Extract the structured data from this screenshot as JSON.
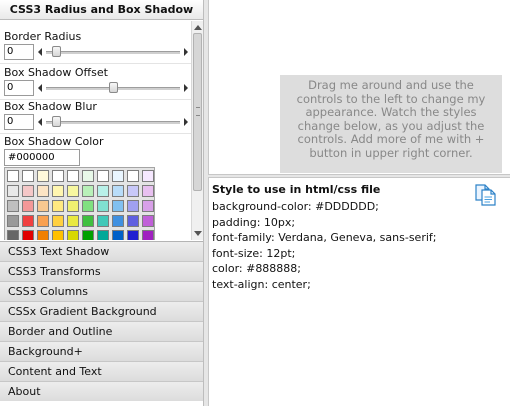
{
  "left_panel": {
    "header": "CSS3 Radius and Box Shadow",
    "controls": {
      "border_radius": {
        "label": "Border Radius",
        "value": "0",
        "slider_fraction": 0.05
      },
      "shadow_offset": {
        "label": "Box Shadow Offset",
        "value": "0",
        "slider_fraction": 0.5
      },
      "shadow_blur": {
        "label": "Box Shadow Blur",
        "value": "0",
        "slider_fraction": 0.05
      },
      "shadow_color": {
        "label": "Box Shadow Color",
        "value": "#000000"
      }
    },
    "palette_colors": [
      "#ffffff",
      "#ffffff",
      "#fff9db",
      "#ffffff",
      "#ffffff",
      "#e8f8e8",
      "#ffffff",
      "#eaf6ff",
      "#ffffff",
      "#f6e8ff",
      "#e8e8e8",
      "#f4c7c7",
      "#fce4c4",
      "#fff6b0",
      "#f7f7a0",
      "#b8f0b8",
      "#b8f0e8",
      "#b8dcf8",
      "#c8c8f8",
      "#e8c0f0",
      "#bfbfbf",
      "#f39898",
      "#f8c890",
      "#ffe880",
      "#f0f070",
      "#80e080",
      "#80e0d0",
      "#80c0f0",
      "#a0a0f0",
      "#d8a0e8",
      "#999999",
      "#f04040",
      "#f8a050",
      "#ffd040",
      "#e8e840",
      "#40c040",
      "#40c8b8",
      "#4090e0",
      "#6060e0",
      "#c060d8",
      "#666666",
      "#e00000",
      "#f08000",
      "#ffc000",
      "#d8d800",
      "#00a000",
      "#00a898",
      "#0060c8",
      "#2020d0",
      "#a020c0"
    ],
    "accordion_items": [
      "CSS3 Text Shadow",
      "CSS3 Transforms",
      "CSS3 Columns",
      "CSSx Gradient Background",
      "Border and Outline",
      "Background+",
      "Content and Text",
      "About"
    ]
  },
  "preview": {
    "text": "Drag me around and use the controls to the left to change my appearance. Watch the styles change below, as you adjust the controls. Add more of me with + button in upper right corner."
  },
  "css_output": {
    "title": "Style to use in html/css file",
    "lines": [
      "background-color: #DDDDDD;",
      "padding: 10px;",
      "font-family: Verdana, Geneva, sans-serif;",
      "font-size: 12pt;",
      "color: #888888;",
      "text-align: center;"
    ]
  },
  "icons": {
    "copy": "copy-icon"
  }
}
